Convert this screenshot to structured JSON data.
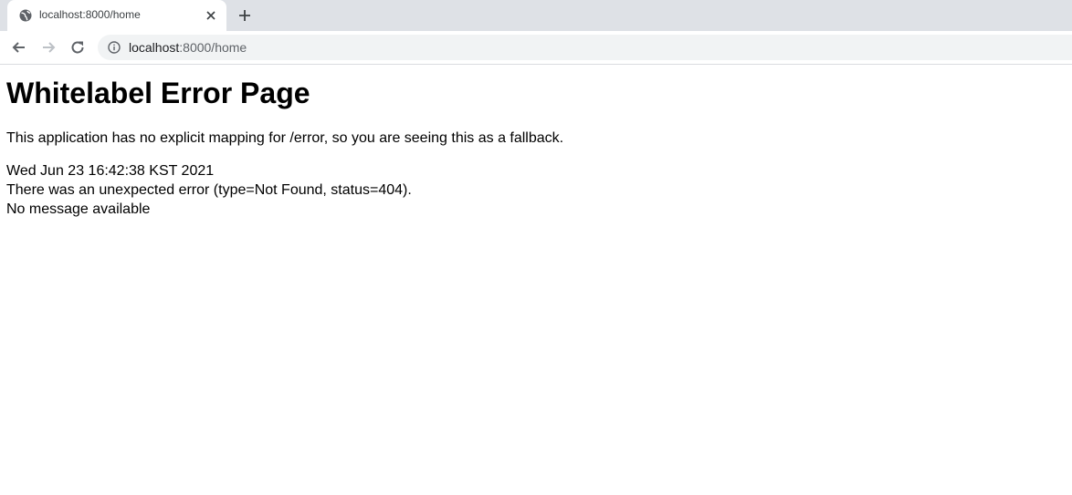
{
  "browser": {
    "tab": {
      "title": "localhost:8000/home"
    },
    "address_bar": {
      "host": "localhost",
      "path": ":8000/home"
    }
  },
  "page": {
    "heading": "Whitelabel Error Page",
    "explanation": "This application has no explicit mapping for /error, so you are seeing this as a fallback.",
    "timestamp": "Wed Jun 23 16:42:38 KST 2021",
    "error_line": "There was an unexpected error (type=Not Found, status=404).",
    "message": "No message available"
  }
}
